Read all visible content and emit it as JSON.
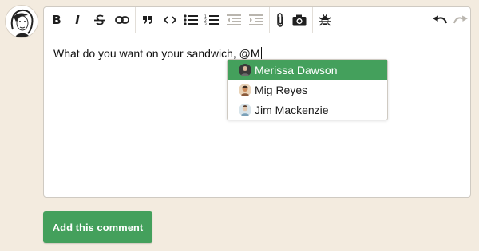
{
  "user": {
    "avatar_icon": "user-sketch-avatar-icon"
  },
  "toolbar": {
    "bold_label": "B",
    "italic_label": "I",
    "buttons": [
      "bold-icon",
      "italic-icon",
      "strikethrough-icon",
      "link-icon",
      "quote-icon",
      "code-icon",
      "bulleted-list-icon",
      "numbered-list-icon",
      "outdent-icon",
      "indent-icon",
      "attachment-icon",
      "camera-icon",
      "bug-icon",
      "undo-icon",
      "redo-icon"
    ]
  },
  "editor": {
    "text": "What do you want on your sandwich, @M"
  },
  "mentions": {
    "items": [
      {
        "name": "Merissa Dawson",
        "avatar_color": "#3a3a3a",
        "active": true
      },
      {
        "name": "Mig Reyes",
        "avatar_color": "#c98a5a",
        "active": false
      },
      {
        "name": "Jim Mackenzie",
        "avatar_color": "#7aa0b8",
        "active": false
      }
    ]
  },
  "submit": {
    "label": "Add this comment"
  },
  "colors": {
    "accent": "#44a05c",
    "background": "#f3ebdf"
  }
}
